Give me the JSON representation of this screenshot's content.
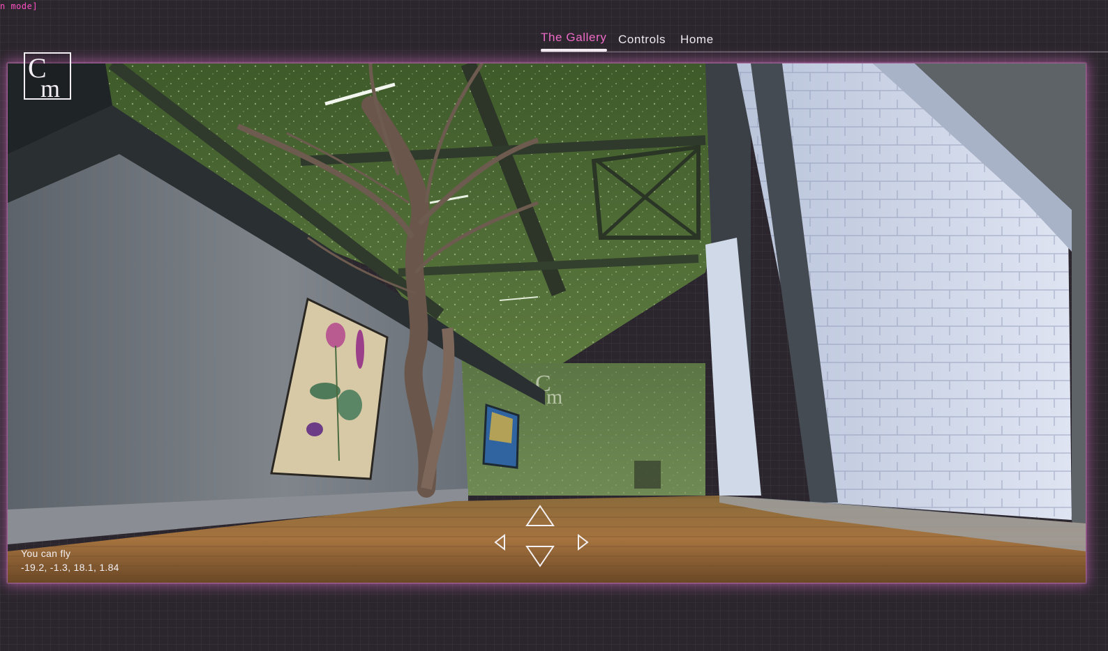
{
  "mode_text": "n mode]",
  "nav": {
    "items": [
      {
        "label": "The Gallery",
        "active": true
      },
      {
        "label": "Controls",
        "active": false
      },
      {
        "label": "Home",
        "active": false
      }
    ]
  },
  "logo": {
    "text_top": "C",
    "text_bottom": "m"
  },
  "status": {
    "message": "You can fly",
    "coordinates": "-19.2, -1.3, 18.1, 1.84"
  },
  "controls": {
    "up": "arrow-up-icon",
    "down": "arrow-down-icon",
    "left": "arrow-left-icon",
    "right": "arrow-right-icon"
  },
  "colors": {
    "accent": "#ee6ac7",
    "background": "#2b262d",
    "glow": "#dc6ec8"
  }
}
